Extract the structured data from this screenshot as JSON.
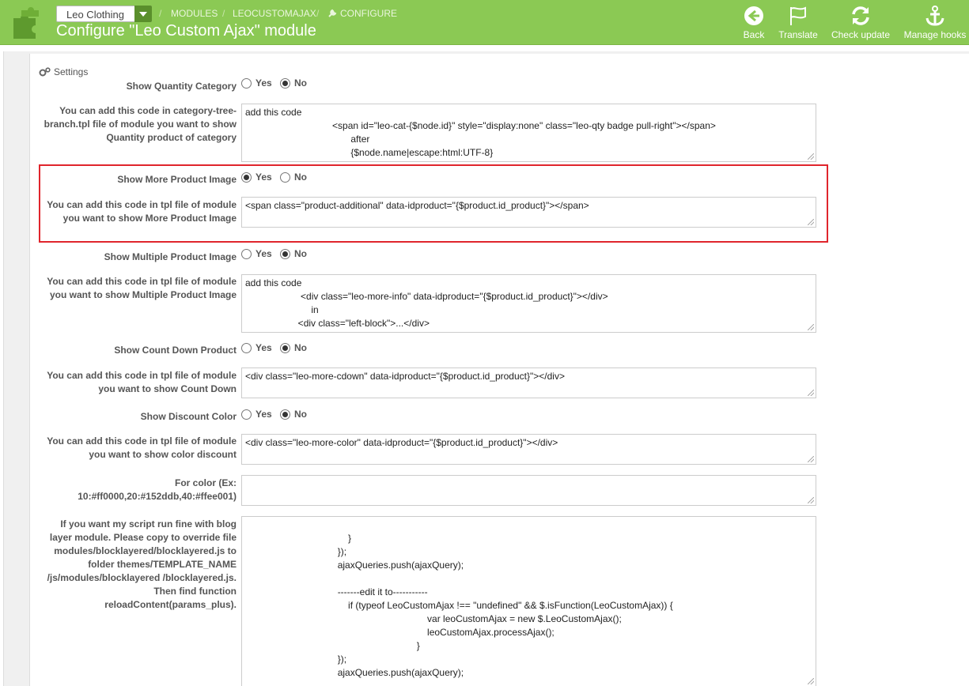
{
  "header": {
    "shop_select": "Leo Clothing",
    "breadcrumb": [
      "MODULES",
      "LEOCUSTOMAJAX",
      "CONFIGURE"
    ],
    "title": "Configure \"Leo Custom Ajax\" module",
    "toolbar": [
      {
        "label": "Back",
        "icon": "back-arrow-icon"
      },
      {
        "label": "Translate",
        "icon": "flag-icon"
      },
      {
        "label": "Check update",
        "icon": "refresh-icon"
      },
      {
        "label": "Manage hooks",
        "icon": "anchor-icon"
      }
    ]
  },
  "panel": {
    "heading": "Settings"
  },
  "radio": {
    "yes": "Yes",
    "no": "No"
  },
  "fields": {
    "qty_cat": {
      "label": "Show Quantity Category",
      "value": "No"
    },
    "qty_cat_code": {
      "label": "You can add this code in category-tree-branch.tpl file of module you want to show Quantity product of category",
      "value": "add this code\n                                 <span id=\"leo-cat-{$node.id}\" style=\"display:none\" class=\"leo-qty badge pull-right\"></span>\n                                        after\n                                        {$node.name|escape:html:UTF-8}"
    },
    "more_img": {
      "label": "Show More Product Image",
      "value": "Yes"
    },
    "more_img_code": {
      "label": "You can add this code in tpl file of module you want to show More Product Image",
      "value": "<span class=\"product-additional\" data-idproduct=\"{$product.id_product}\"></span>"
    },
    "multi_img": {
      "label": "Show Multiple Product Image",
      "value": "No"
    },
    "multi_img_code": {
      "label": "You can add this code in tpl file of module you want to show Multiple Product Image",
      "value": "add this code\n                     <div class=\"leo-more-info\" data-idproduct=\"{$product.id_product}\"></div>\n                         in\n                    <div class=\"left-block\">...</div>"
    },
    "countdown": {
      "label": "Show Count Down Product",
      "value": "No"
    },
    "countdown_code": {
      "label": "You can add this code in tpl file of module you want to show Count Down",
      "value": "<div class=\"leo-more-cdown\" data-idproduct=\"{$product.id_product}\"></div>"
    },
    "discount": {
      "label": "Show Discount Color",
      "value": "No"
    },
    "discount_code": {
      "label": "You can add this code in tpl file of module you want to show color discount",
      "value": "<div class=\"leo-more-color\" data-idproduct=\"{$product.id_product}\"></div>"
    },
    "for_color": {
      "label": "For color (Ex: 10:#ff0000,20:#152ddb,40:#ffee001)",
      "value": ""
    },
    "blog_layer": {
      "label": "If you want my script run fine with blog layer module. Please copy to override file modules/blocklayered/blocklayered.js to folder themes/TEMPLATE_NAME /js/modules/blocklayered /blocklayered.js. Then find function reloadContent(params_plus).",
      "value": "\n                                       }\n                                   });\n                                   ajaxQueries.push(ajaxQuery);\n\n                                   -------edit it to-----------\n                                       if (typeof LeoCustomAjax !== \"undefined\" && $.isFunction(LeoCustomAjax)) {\n                                                                     var leoCustomAjax = new $.LeoCustomAjax();\n                                                                     leoCustomAjax.processAjax();\n                                                                 }\n                                   });\n                                   ajaxQueries.push(ajaxQuery);"
    }
  }
}
